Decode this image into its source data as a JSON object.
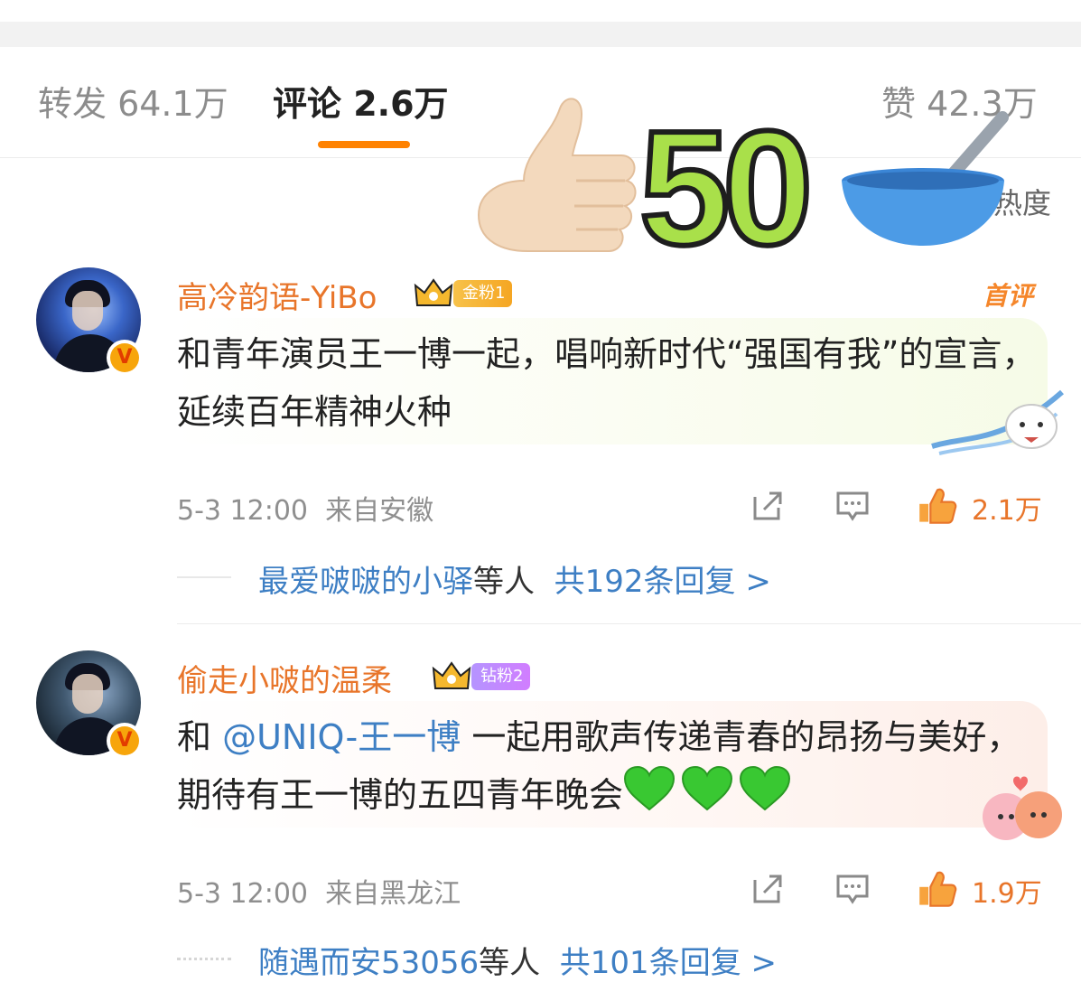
{
  "tabs": {
    "reposts": "转发 64.1万",
    "comments": "评论 2.6万",
    "likes": "赞 42.3万",
    "sort_label": "热度"
  },
  "sticker": {
    "number": "50"
  },
  "comments": [
    {
      "username": "高冷韵语-YiBo",
      "fan_badge": "金粉1",
      "first_tag": "首评",
      "text": "和青年演员王一博一起，唱响新时代“强国有我”的宣言，延续百年精神火种",
      "time": "5-3 12:00",
      "location": "来自安徽",
      "likes": "2.1万",
      "reply_users": "最爱啵啵的小驿",
      "reply_mid": "等人",
      "reply_count": "共192条回复 >"
    },
    {
      "username": "偷走小啵的温柔",
      "fan_badge": "钻粉2",
      "text_prefix": "和 ",
      "mention": "@UNIQ-王一博",
      "text_suffix": " 一起用歌声传递青春的昂扬与美好，期待有王一博的五四青年晚会",
      "time": "5-3 12:00",
      "location": "来自黑龙江",
      "likes": "1.9万",
      "reply_users": "随遇而安53056",
      "reply_mid": "等人",
      "reply_count": "共101条回复 >"
    }
  ],
  "colors": {
    "accent_orange": "#ff8200",
    "username_orange": "#e8752a",
    "link_blue": "#3e7fc4",
    "heart_green": "#39c832"
  },
  "icons": [
    "thumbs-up-sticker",
    "bowl-spoon-sticker",
    "crown-icon",
    "share-icon",
    "comment-icon",
    "like-icon",
    "green-heart-icon",
    "cat-ribbon-sticker",
    "couple-sticker"
  ]
}
